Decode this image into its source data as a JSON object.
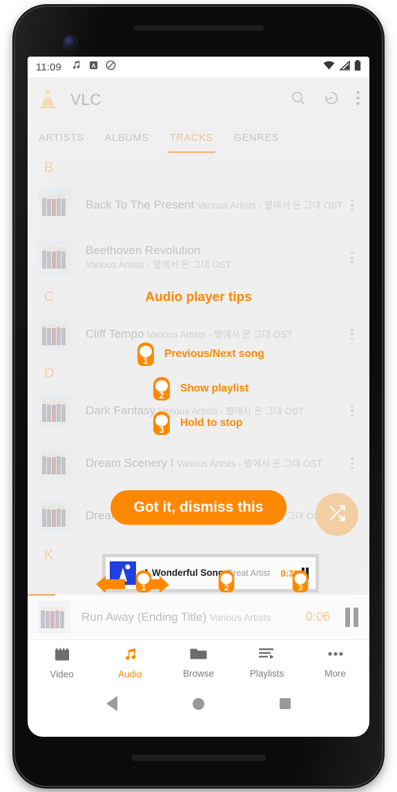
{
  "statusbar": {
    "time": "11:09",
    "left_icons": [
      "music-note-icon",
      "a-badge-icon",
      "do-not-disturb-icon"
    ],
    "right_icons": [
      "wifi-icon",
      "cellular-signal-icon",
      "battery-icon"
    ]
  },
  "appbar": {
    "title": "VLC",
    "logo": "vlc-cone-icon",
    "actions": [
      "search-icon",
      "history-icon",
      "overflow-menu-icon"
    ]
  },
  "tabs": [
    {
      "label": "ARTISTS",
      "active": false
    },
    {
      "label": "ALBUMS",
      "active": false
    },
    {
      "label": "TRACKS",
      "active": true
    },
    {
      "label": "GENRES",
      "active": false
    }
  ],
  "list": {
    "sections": [
      {
        "letter": "B",
        "tracks": [
          {
            "title": "Back To The Present",
            "subtitle": "Various Artists - 별에서 온 그대 OST"
          },
          {
            "title": "Beethoven Revolution",
            "subtitle": "Various Artists - 별에서 온 그대 OST"
          }
        ]
      },
      {
        "letter": "C",
        "tracks": [
          {
            "title": "Cliff Tempo",
            "subtitle": "Various Artists - 별에서 온 그대 OST"
          }
        ]
      },
      {
        "letter": "D",
        "tracks": [
          {
            "title": "Dark Fantasy",
            "subtitle": "Various Artists - 별에서 온 그대 OST"
          },
          {
            "title": "Dream Scenery I",
            "subtitle": "Various Artists - 별에서 온 그대 OST"
          },
          {
            "title": "Dream Scenery II",
            "subtitle": "Various Artists - 별에서 온 그대 OST"
          }
        ]
      },
      {
        "letter": "K",
        "tracks": []
      }
    ],
    "fab": "shuffle-icon"
  },
  "now_playing": {
    "title": "Run Away (Ending Title)",
    "artist": "Various Artists",
    "time": "0:06",
    "transport": "pause-icon"
  },
  "bottom_nav": [
    {
      "label": "Video",
      "icon": "movie-clapper-icon",
      "active": false
    },
    {
      "label": "Audio",
      "icon": "music-note-icon",
      "active": true
    },
    {
      "label": "Browse",
      "icon": "folder-icon",
      "active": false
    },
    {
      "label": "Playlists",
      "icon": "playlist-icon",
      "active": false
    },
    {
      "label": "More",
      "icon": "more-horizontal-icon",
      "active": false
    }
  ],
  "system_nav": {
    "back": "back-triangle-icon",
    "home": "home-circle-icon",
    "recents": "recents-square-icon"
  },
  "tips": {
    "title": "Audio player tips",
    "items": [
      {
        "number": "1",
        "label": "Previous/Next song"
      },
      {
        "number": "2",
        "label": "Show playlist"
      },
      {
        "number": "3",
        "label": "Hold to stop"
      }
    ],
    "dismiss_label": "Got it, dismiss this",
    "demo_player": {
      "title": "A Wonderful Song",
      "artist": "Great Artist",
      "time": "0:30",
      "badges": [
        "1",
        "2",
        "3"
      ],
      "arrows": [
        "arrow-left-icon",
        "arrow-right-icon"
      ]
    }
  },
  "colors": {
    "accent": "#ff8800",
    "accent_faded": "#f3cea3",
    "tab_active": "#f2c08a",
    "list_bg": "#efefef",
    "appbar_bg": "#f0f0f0"
  }
}
